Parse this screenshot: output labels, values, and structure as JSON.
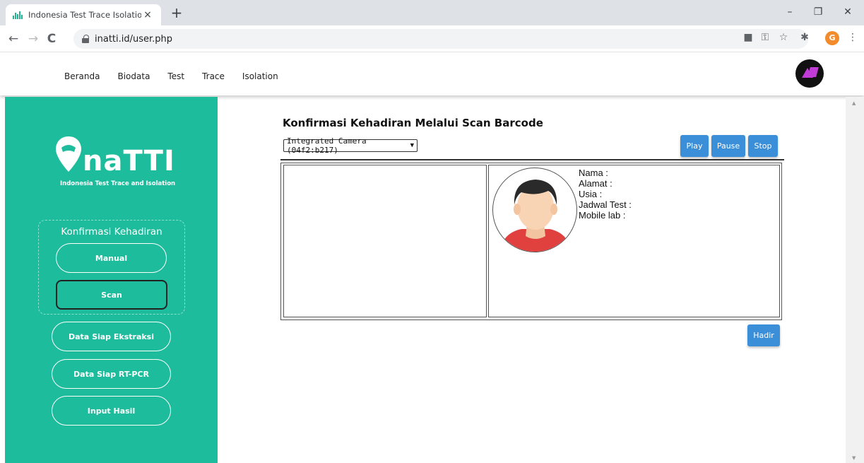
{
  "browser": {
    "tab_title": "Indonesia Test Trace Isolation",
    "tab_close": "×",
    "new_tab": "+",
    "url": "inatti.id/user.php",
    "profile_initial": "G",
    "win_min": "–",
    "win_restore": "❐",
    "win_close": "✕",
    "back": "←",
    "forward": "→",
    "reload": "C"
  },
  "topnav": {
    "items": [
      "Beranda",
      "Biodata",
      "Test",
      "Trace",
      "Isolation"
    ]
  },
  "sidebar": {
    "brand": "naTTI",
    "tagline": "Indonesia Test Trace and Isolation",
    "group_title": "Konfirmasi Kehadiran",
    "group_items": [
      "Manual",
      "Scan"
    ],
    "items": [
      "Data Siap Ekstraksi",
      "Data Siap RT-PCR",
      "Input Hasil"
    ]
  },
  "main": {
    "title": "Konfirmasi Kehadiran Melalui Scan Barcode",
    "camera_select": "Integrated Camera (04f2:b217)",
    "play": "Play",
    "pause": "Pause",
    "stop": "Stop",
    "hadir": "Hadir",
    "fields": [
      "Nama :",
      "Alamat :",
      "Usia :",
      "Jadwal Test :",
      "Mobile lab :"
    ]
  },
  "colors": {
    "sidebar": "#1dbc9c",
    "button": "#3b8fd9"
  }
}
